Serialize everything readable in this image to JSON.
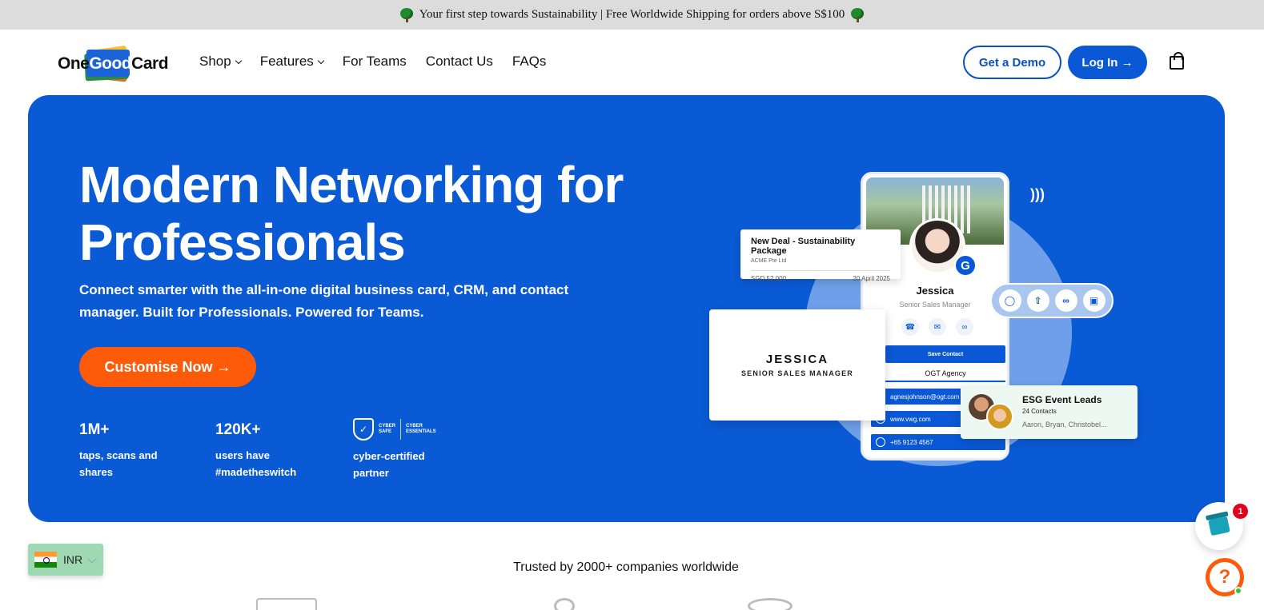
{
  "announcement": {
    "text": "Your first step towards Sustainability | Free Worldwide Shipping for orders above S$100"
  },
  "nav": {
    "logo_one": "One",
    "logo_good": "Good",
    "logo_card": "Card",
    "items": [
      {
        "label": "Shop",
        "has_dropdown": true
      },
      {
        "label": "Features",
        "has_dropdown": true
      },
      {
        "label": "For Teams",
        "has_dropdown": false
      },
      {
        "label": "Contact Us",
        "has_dropdown": false
      },
      {
        "label": "FAQs",
        "has_dropdown": false
      }
    ],
    "demo_label": "Get a Demo",
    "login_label": "Log In →"
  },
  "hero": {
    "title": "Modern Networking for Professionals",
    "subtitle": "Connect smarter with the all-in-one digital business card, CRM, and contact manager. Built for Professionals. Powered for Teams.",
    "cta_label": "Customise Now →",
    "stats": [
      {
        "big": "1M+",
        "line1": "taps, scans and",
        "line2": "shares"
      },
      {
        "big": "120K+",
        "line1": "users have",
        "line2": "#madetheswitch"
      },
      {
        "line1": "cyber-certified",
        "line2": "partner"
      }
    ],
    "cyber_badge": {
      "left1": "CYBER",
      "left2": "SAFE",
      "right1": "CYBER",
      "right2": "ESSENTIALS"
    },
    "deal_card": {
      "title": "New Deal - Sustainability Package",
      "company": "ACME Pte Ltd",
      "amount": "SGD 52,000",
      "date": "20 April 2025"
    },
    "phone": {
      "name": "Jessica",
      "role": "Senior Sales Manager",
      "save_label": "Save Contact",
      "agency": "OGT Agency",
      "email": "agnesjohnson@ogt.com",
      "website": "www.vwg.com",
      "phone": "+65 9123 4567",
      "badge_letter": "G"
    },
    "business_card": {
      "name": "JESSICA",
      "role": "SENIOR SALES MANAGER"
    },
    "esg_card": {
      "title": "ESG Event Leads",
      "count": "24 Contacts",
      "people": "Aaron, Bryan, Christobel..."
    }
  },
  "trusted": {
    "text": "Trusted by 2000+ companies worldwide"
  },
  "currency": {
    "code": "INR"
  },
  "widgets": {
    "gift_badge": "1",
    "help_label": "?"
  },
  "colors": {
    "brand_blue": "#0a5ad6",
    "cta_orange": "#fd5b0a",
    "announce_bg": "#dcdcdc"
  }
}
